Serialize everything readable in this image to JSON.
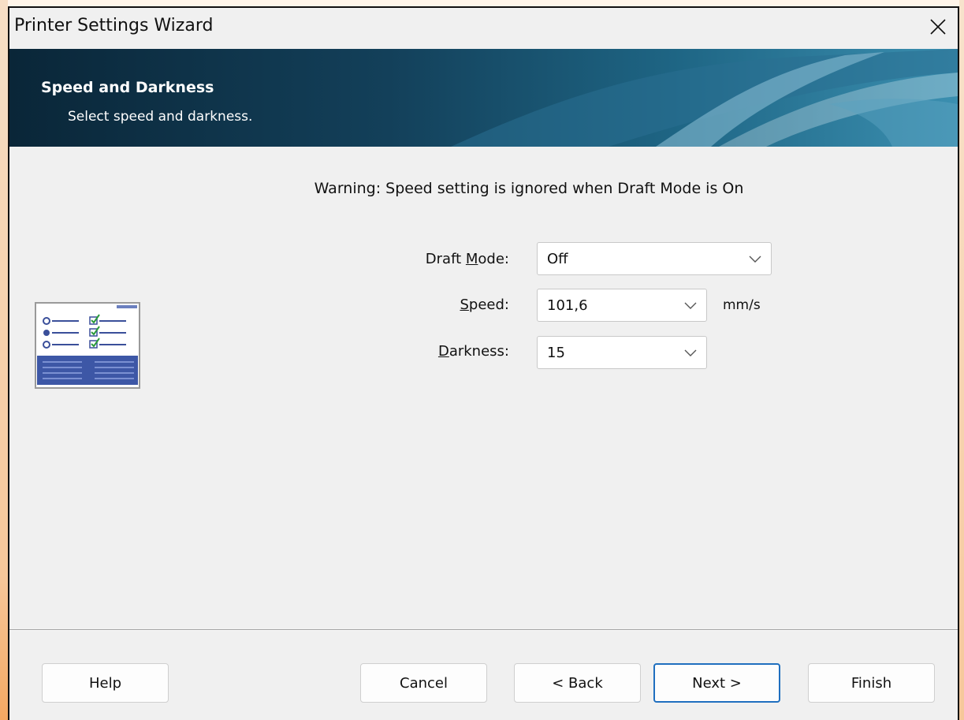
{
  "window": {
    "title": "Printer Settings Wizard"
  },
  "banner": {
    "title": "Speed and Darkness",
    "subtitle": "Select speed and darkness."
  },
  "warning": "Warning: Speed setting is ignored when Draft Mode is On",
  "form": {
    "draft_mode": {
      "label_pre": "Draft ",
      "label_mnemonic": "M",
      "label_post": "ode:",
      "value": "Off"
    },
    "speed": {
      "label_pre": "",
      "label_mnemonic": "S",
      "label_post": "peed:",
      "value": "101,6",
      "unit": "mm/s"
    },
    "darkness": {
      "label_pre": "",
      "label_mnemonic": "D",
      "label_post": "arkness:",
      "value": "15"
    }
  },
  "buttons": {
    "help": "Help",
    "cancel": "Cancel",
    "back": "< Back",
    "next": "Next >",
    "finish": "Finish"
  },
  "icons": {
    "close": "close-icon",
    "wizard": "checklist-wizard-icon",
    "dropdown": "chevron-down-icon"
  },
  "colors": {
    "accent": "#1f6fbf",
    "banner_dark": "#0a2638",
    "banner_light": "#3b8fb0"
  }
}
